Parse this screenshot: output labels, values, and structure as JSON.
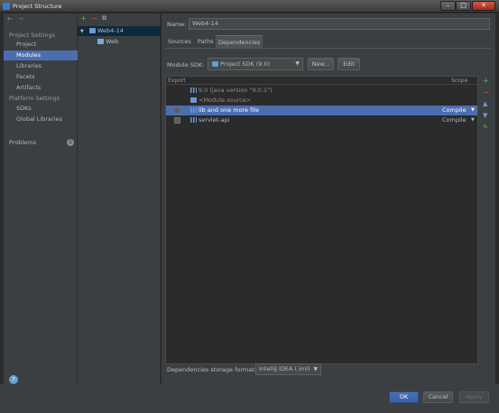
{
  "window": {
    "title": "Project Structure"
  },
  "nav": {
    "project_settings_title": "Project Settings",
    "project_settings": [
      {
        "label": "Project",
        "selected": false
      },
      {
        "label": "Modules",
        "selected": true
      },
      {
        "label": "Libraries",
        "selected": false
      },
      {
        "label": "Facets",
        "selected": false
      },
      {
        "label": "Artifacts",
        "selected": false
      }
    ],
    "platform_settings_title": "Platform Settings",
    "platform_settings": [
      {
        "label": "SDKs"
      },
      {
        "label": "Global Libraries"
      }
    ],
    "problems_label": "Problems",
    "problems_count": "1"
  },
  "tree": {
    "module": "Web4-14",
    "child": "Web"
  },
  "module": {
    "name_label": "Name:",
    "name_value": "Web4-14",
    "tabs": [
      "Sources",
      "Paths",
      "Dependencies"
    ],
    "active_tab": "Dependencies",
    "sdk_label": "Module SDK:",
    "sdk_value": "Project SDK (9.0)",
    "new_button": "New...",
    "edit_button": "Edit"
  },
  "dependencies": {
    "col_export": "Export",
    "col_scope": "Scope",
    "rows": [
      {
        "name": "9.0 (java version \"9.0.1\")",
        "scope": "",
        "checkbox": false,
        "selected": false,
        "dim": true
      },
      {
        "name": "<Module source>",
        "scope": "",
        "checkbox": false,
        "selected": false,
        "dim": true
      },
      {
        "name": "lib and one more file",
        "scope": "Compile",
        "checkbox": true,
        "selected": true,
        "dim": false
      },
      {
        "name": "servlet-api",
        "scope": "Compile",
        "checkbox": true,
        "selected": false,
        "dim": false
      }
    ]
  },
  "storage": {
    "label": "Dependencies storage format:",
    "value": "IntelliJ IDEA (.iml)"
  },
  "dialog": {
    "ok": "OK",
    "cancel": "Cancel",
    "apply": "Apply"
  },
  "colors": {
    "selection": "#4b6eaf",
    "panel": "#3c3f41",
    "background": "#2b2b2b",
    "add_icon": "#5fb14c",
    "remove_icon": "#c75450",
    "accent_blue": "#6a9bd6"
  }
}
